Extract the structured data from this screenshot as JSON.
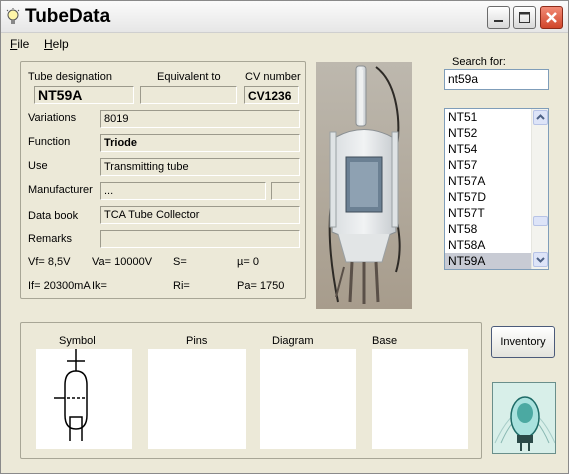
{
  "window": {
    "title": "TubeData"
  },
  "menu": [
    {
      "label": "File",
      "hotkey": "F",
      "rest": "ile"
    },
    {
      "label": "Help",
      "hotkey": "H",
      "rest": "elp"
    }
  ],
  "fields": {
    "tube_designation_label": "Tube designation",
    "tube_designation": "NT59A",
    "equivalent_label": "Equivalent to",
    "equivalent": "",
    "cv_label": "CV number",
    "cv": "CV1236",
    "variations_label": "Variations",
    "variations": "8019",
    "function_label": "Function",
    "function": "Triode",
    "use_label": "Use",
    "use": "Transmitting tube",
    "manufacturer_label": "Manufacturer",
    "manufacturer": "...",
    "manufacturer_code": "",
    "databook_label": "Data book",
    "databook": "TCA Tube Collector",
    "remarks_label": "Remarks",
    "remarks": ""
  },
  "specs": {
    "vf": "Vf= 8,5V",
    "va": "Va= 10000V",
    "s": "S=",
    "mu": "µ=    0",
    "if": "If= 20300mA",
    "ik": "Ik=",
    "ri": "Ri=",
    "pa": "Pa= 1750"
  },
  "search": {
    "label": "Search for:",
    "value": "nt59a"
  },
  "tube_list": {
    "items": [
      "NT51",
      "NT52",
      "NT54",
      "NT57",
      "NT57A",
      "NT57D",
      "NT57T",
      "NT58",
      "NT58A",
      "NT59A"
    ],
    "selected": "NT59A"
  },
  "bottom": {
    "symbol_label": "Symbol",
    "pins_label": "Pins",
    "diagram_label": "Diagram",
    "base_label": "Base",
    "inventory_label": "Inventory"
  }
}
